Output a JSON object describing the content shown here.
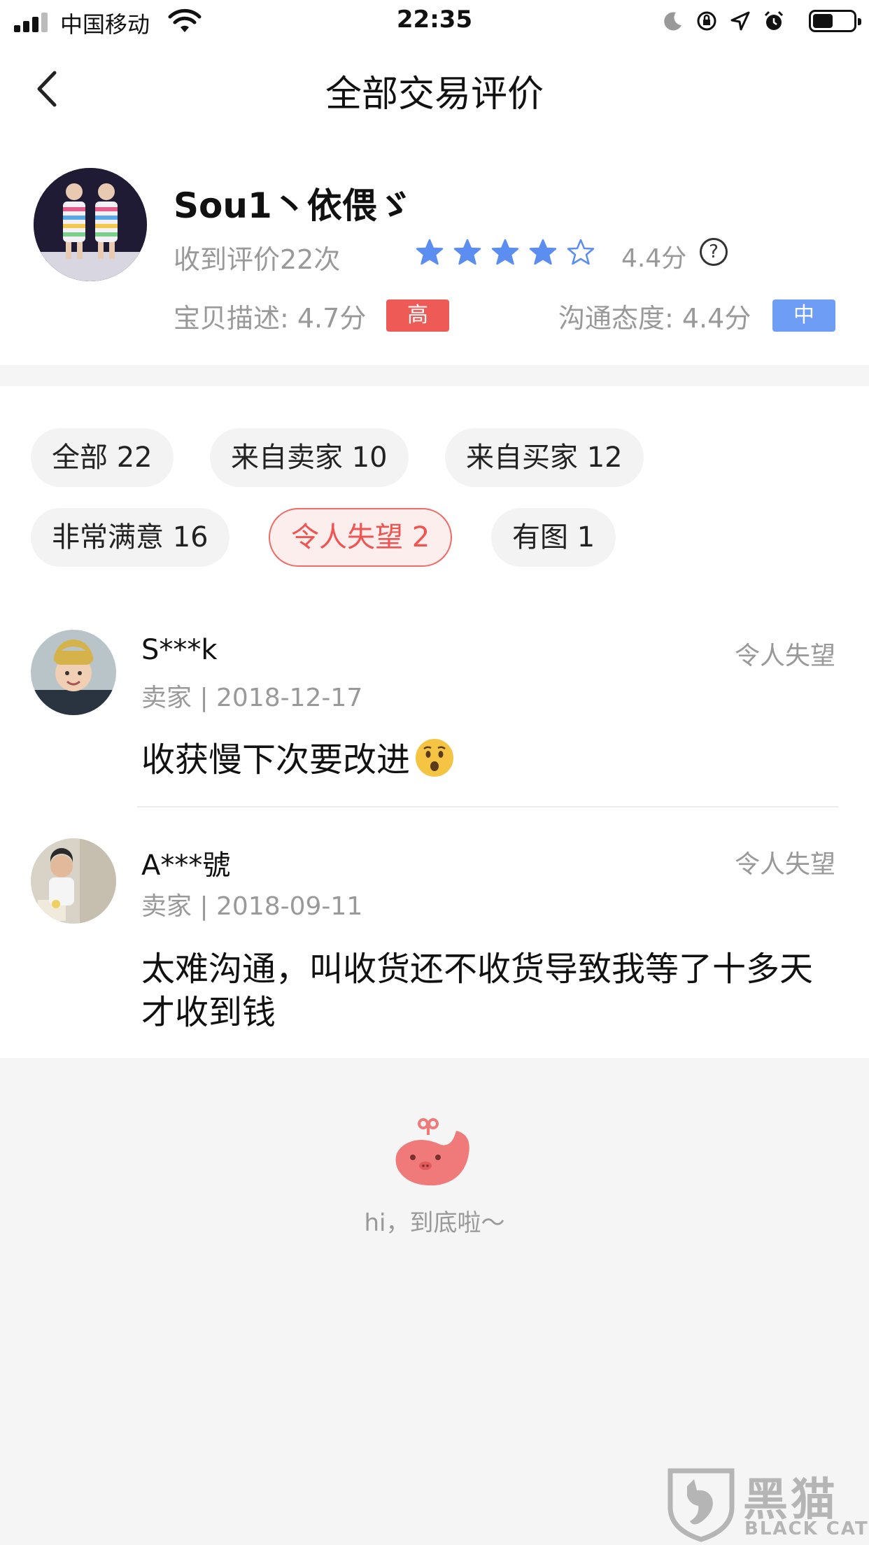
{
  "status_bar": {
    "carrier": "中国移动",
    "time": "22:35",
    "battery_level": 0.5
  },
  "nav": {
    "title": "全部交易评价"
  },
  "profile": {
    "name": "Sou1丶依偎ゞ",
    "rating_count": "收到评价22次",
    "stars": 4,
    "score": "4.4分",
    "help": "?",
    "desc_score": "宝贝描述: 4.7分",
    "desc_badge": "高",
    "comm_score": "沟通态度: 4.4分",
    "comm_badge": "中",
    "star_color": "#5b8ef0",
    "badge_high_color": "#ee5a55",
    "badge_mid_color": "#6d9df5"
  },
  "filters": [
    {
      "label": "全部 22",
      "active": false
    },
    {
      "label": "来自卖家 10",
      "active": false
    },
    {
      "label": "来自买家 12",
      "active": false
    },
    {
      "label": "非常满意 16",
      "active": false
    },
    {
      "label": "令人失望 2",
      "active": true
    },
    {
      "label": "有图 1",
      "active": false
    }
  ],
  "reviews": [
    {
      "user": "S***k",
      "tag": "令人失望",
      "meta": "卖家 | 2018-12-17",
      "text": "收获慢下次要改进",
      "emoji": "hushed-face-icon"
    },
    {
      "user": "A***號",
      "tag": "令人失望",
      "meta": "卖家 | 2018-09-11",
      "text": "太难沟通，叫收货还不收货导致我等了十多天才收到钱"
    }
  ],
  "footer": {
    "text": "hi，到底啦～"
  },
  "watermark": {
    "cn": "黑猫",
    "en": "BLACK CAT"
  }
}
